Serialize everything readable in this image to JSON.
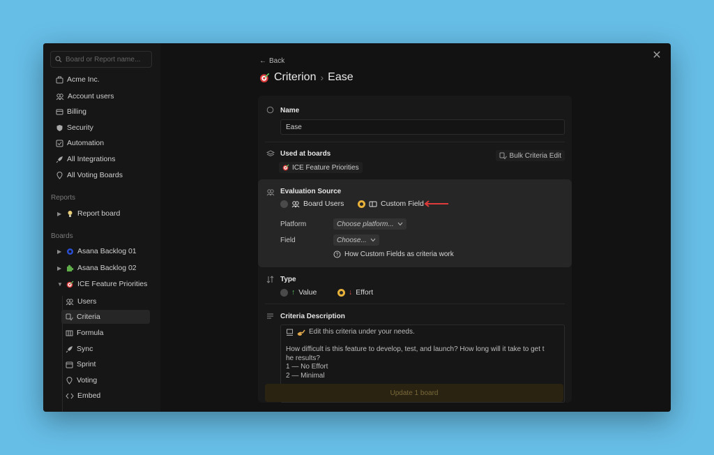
{
  "sidebar": {
    "search_placeholder": "Board or Report name...",
    "nav_items": [
      {
        "label": "Acme Inc.",
        "icon": "building-icon"
      },
      {
        "label": "Account users",
        "icon": "users-icon"
      },
      {
        "label": "Billing",
        "icon": "billing-icon"
      },
      {
        "label": "Security",
        "icon": "shield-icon"
      },
      {
        "label": "Automation",
        "icon": "automation-icon"
      },
      {
        "label": "All Integrations",
        "icon": "rocket-icon"
      },
      {
        "label": "All Voting Boards",
        "icon": "pin-icon"
      }
    ],
    "reports_label": "Reports",
    "reports": [
      {
        "label": "Report board",
        "icon": "bulb-icon"
      }
    ],
    "boards_label": "Boards",
    "boards": [
      {
        "label": "Asana Backlog 01",
        "icon": "swirl-icon"
      },
      {
        "label": "Asana Backlog 02",
        "icon": "puzzle-icon"
      },
      {
        "label": "ICE Feature Priorities",
        "icon": "target-icon"
      }
    ],
    "sub_items": [
      {
        "label": "Users",
        "icon": "users-icon"
      },
      {
        "label": "Criteria",
        "icon": "criteria-icon"
      },
      {
        "label": "Formula",
        "icon": "formula-icon"
      },
      {
        "label": "Sync",
        "icon": "rocket-icon"
      },
      {
        "label": "Sprint",
        "icon": "calendar-icon"
      },
      {
        "label": "Voting",
        "icon": "pin-icon"
      },
      {
        "label": "Embed",
        "icon": "code-icon"
      }
    ]
  },
  "header": {
    "back_label": "Back",
    "title": "Criterion",
    "subtitle": "Ease"
  },
  "form": {
    "name_label": "Name",
    "name_value": "Ease",
    "used_label": "Used at boards",
    "used_board": "ICE Feature Priorities",
    "bulk_edit_label": "Bulk Criteria Edit",
    "eval_label": "Evaluation Source",
    "eval_options": [
      {
        "label": "Board Users",
        "selected": false
      },
      {
        "label": "Custom Field",
        "selected": true
      }
    ],
    "platform_label": "Platform",
    "platform_value": "Choose platform...",
    "field_label": "Field",
    "field_value": "Choose...",
    "help_link": "How Custom Fields as criteria work",
    "type_label": "Type",
    "type_options": [
      {
        "label": "Value",
        "selected": false
      },
      {
        "label": "Effort",
        "selected": true
      }
    ],
    "desc_label": "Criteria Description",
    "desc_lines": [
      "Edit this criteria under your needs.",
      "",
      "How difficult is this feature to develop, test, and launch? How long will it take to get t",
      "he results?",
      "1 — No Effort",
      "2 — Minimal"
    ],
    "update_button": "Update 1 board"
  },
  "colors": {
    "accent": "#e8b23a",
    "arrow": "#e03a3a",
    "background": "#66bde6"
  }
}
